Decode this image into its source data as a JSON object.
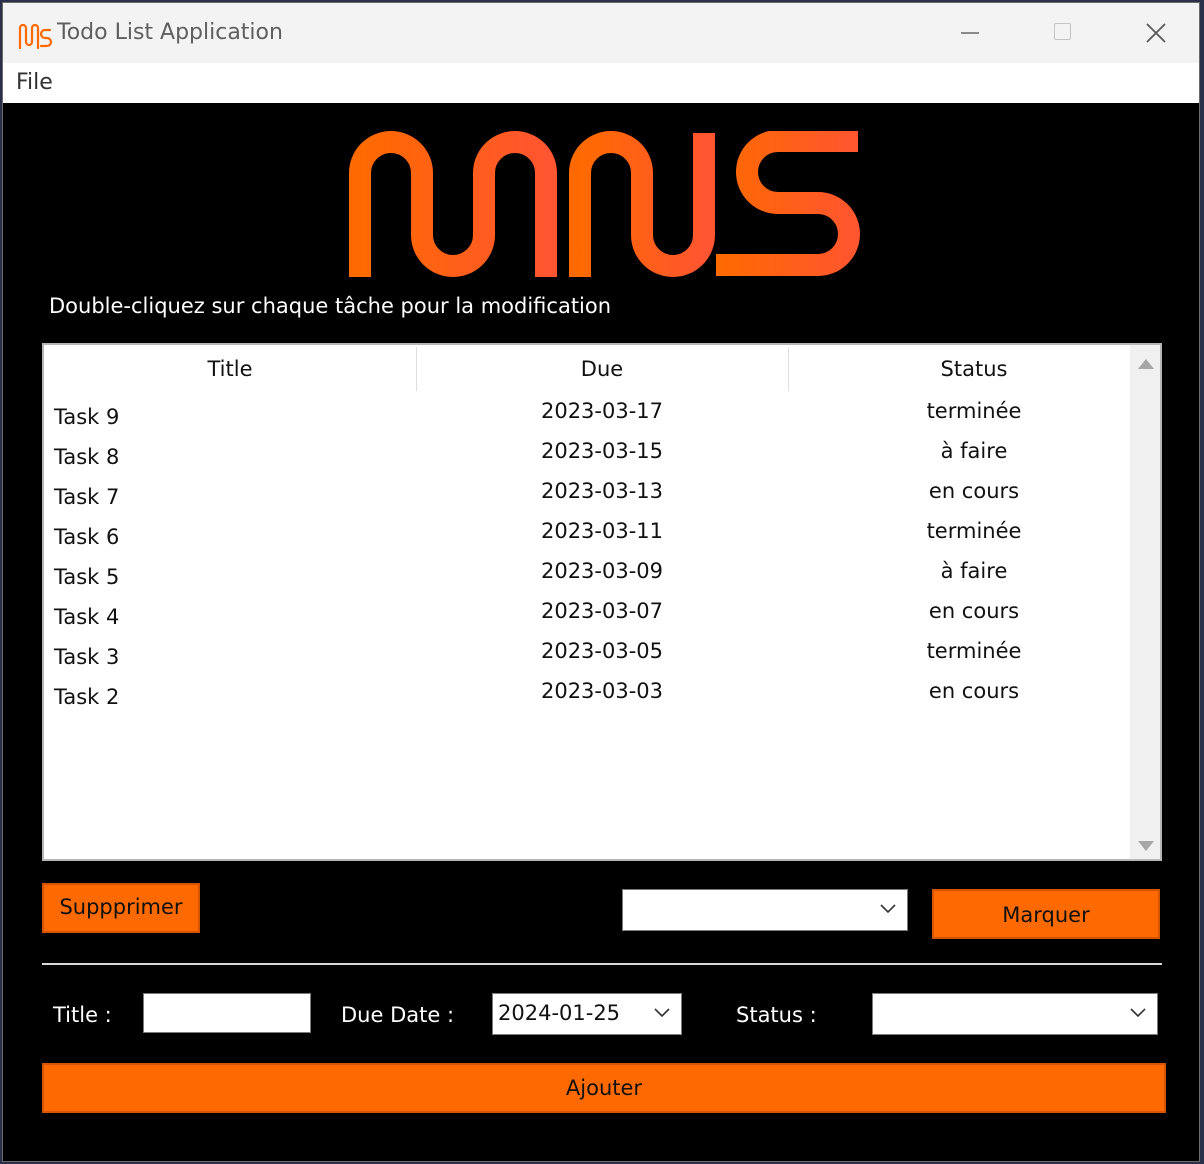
{
  "window": {
    "title": "Todo List Application",
    "logo_text": "MNS",
    "accent_color": "#ff6a00"
  },
  "menu": {
    "file": "File"
  },
  "instruction": "Double-cliquez sur chaque tâche pour la modification",
  "table": {
    "columns": [
      "Title",
      "Due",
      "Status"
    ],
    "rows": [
      {
        "title": "Task 9",
        "due": "2023-03-17",
        "status": "terminée"
      },
      {
        "title": "Task 8",
        "due": "2023-03-15",
        "status": "à faire"
      },
      {
        "title": "Task 7",
        "due": "2023-03-13",
        "status": "en cours"
      },
      {
        "title": "Task 6",
        "due": "2023-03-11",
        "status": "terminée"
      },
      {
        "title": "Task 5",
        "due": "2023-03-09",
        "status": "à faire"
      },
      {
        "title": "Task 4",
        "due": "2023-03-07",
        "status": "en cours"
      },
      {
        "title": "Task 3",
        "due": "2023-03-05",
        "status": "terminée"
      },
      {
        "title": "Task 2",
        "due": "2023-03-03",
        "status": "en cours"
      }
    ]
  },
  "actions": {
    "delete_label": "Suppprimer",
    "mark_label": "Marquer",
    "mark_status_value": "",
    "add_label": "Ajouter"
  },
  "form": {
    "title_label": "Title :",
    "title_value": "",
    "due_label": "Due Date :",
    "due_value": "2024-01-25",
    "status_label": "Status :",
    "status_value": ""
  },
  "icons": {
    "app": "mns-logo-icon",
    "minimize": "minimize-icon",
    "maximize": "maximize-icon",
    "close": "close-icon",
    "dropdown": "chevron-down-icon"
  }
}
